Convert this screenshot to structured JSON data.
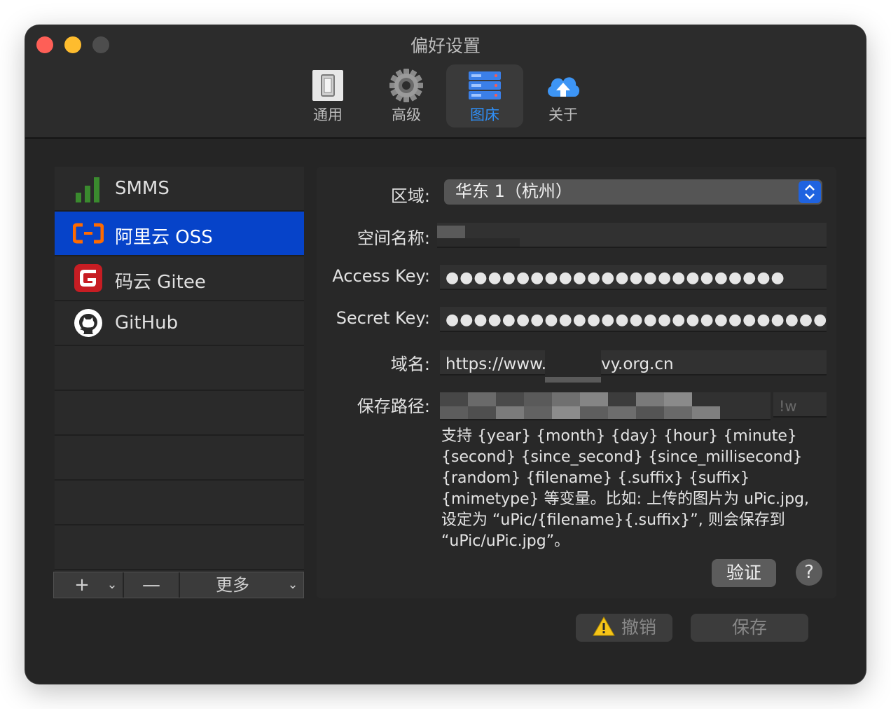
{
  "window": {
    "title": "偏好设置"
  },
  "tabs": [
    {
      "label": "通用",
      "icon": "switch-icon"
    },
    {
      "label": "高级",
      "icon": "gear-icon"
    },
    {
      "label": "图床",
      "icon": "server-icon",
      "active": true
    },
    {
      "label": "关于",
      "icon": "cloud-upload-icon"
    }
  ],
  "sidebar": {
    "items": [
      {
        "label": "SMMS",
        "icon": "smms-bars-icon"
      },
      {
        "label": "阿里云 OSS",
        "icon": "aliyun-icon",
        "selected": true
      },
      {
        "label": "码云 Gitee",
        "icon": "gitee-icon"
      },
      {
        "label": "GitHub",
        "icon": "github-icon"
      }
    ],
    "toolbar": {
      "add": "+",
      "remove": "—",
      "more": "更多"
    }
  },
  "form": {
    "region_label": "区域:",
    "region_value": "华东 1（杭州）",
    "bucket_label": "空间名称:",
    "access_key_label": "Access Key:",
    "access_key_value": "●●●●●●●●●●●●●●●●●●●●●●●●",
    "secret_key_label": "Secret Key:",
    "secret_key_value": "●●●●●●●●●●●●●●●●●●●●●●●●●●●●●●",
    "domain_label": "域名:",
    "domain_value_prefix": "https://www.",
    "domain_value_suffix": "vy.org.cn",
    "path_label": "保存路径:",
    "path_suffix_placeholder": "!w",
    "help_text": "支持 {year} {month} {day} {hour} {minute} {second} {since_second} {since_millisecond} {random} {filename} {.suffix} {suffix} {mimetype} 等变量。比如: 上传的图片为 uPic.jpg, 设定为 “uPic/{filename}{.suffix}”, 则会保存到 “uPic/uPic.jpg”。",
    "verify_button": "验证",
    "help_button": "?"
  },
  "footer": {
    "undo_button": "撤销",
    "save_button": "保存"
  },
  "colors": {
    "accent": "#2f8ff7",
    "selection": "#0643c9",
    "window_bg": "#252525"
  }
}
